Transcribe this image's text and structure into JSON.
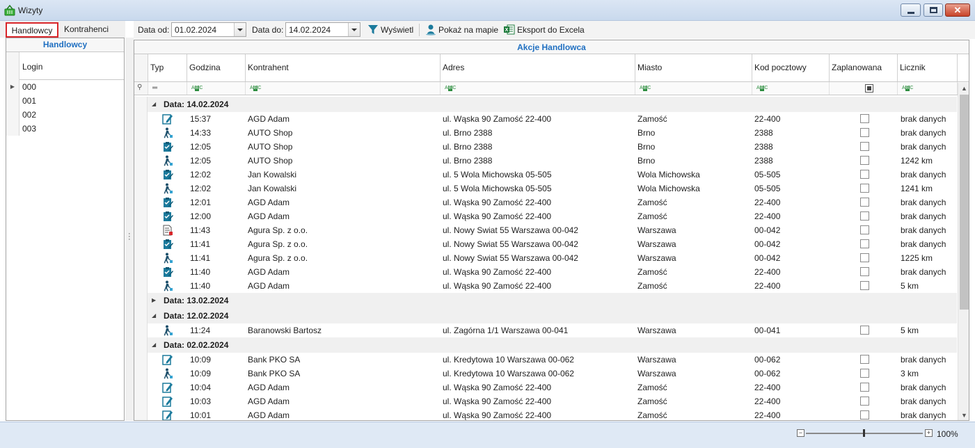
{
  "window": {
    "title": "Wizyty"
  },
  "left": {
    "tabs": [
      "Handlowcy",
      "Kontrahenci"
    ],
    "panel_title": "Handlowcy",
    "column": "Login",
    "logins": [
      "000",
      "001",
      "002",
      "003"
    ]
  },
  "toolbar": {
    "date_from_label": "Data od:",
    "date_from_value": "01.02.2024",
    "date_to_label": "Data do:",
    "date_to_value": "14.02.2024",
    "show_label": "Wyświetl",
    "map_label": "Pokaż na mapie",
    "excel_label": "Eksport do Excela"
  },
  "grid": {
    "title": "Akcje Handlowca",
    "columns": [
      "Typ",
      "Godzina",
      "Kontrahent",
      "Adres",
      "Miasto",
      "Kod pocztowy",
      "Zaplanowana",
      "Licznik"
    ],
    "groups": [
      {
        "label": "Data: 14.02.2024",
        "expanded": true,
        "rows": [
          {
            "icon": "pen-icon",
            "time": "15:37",
            "contractor": "AGD Adam",
            "address": "ul. Wąska 90 Zamość 22-400",
            "city": "Zamość",
            "postal": "22-400",
            "counter": "brak danych"
          },
          {
            "icon": "walk-icon",
            "time": "14:33",
            "contractor": "AUTO Shop",
            "address": "ul.  Brno 2388",
            "city": "Brno",
            "postal": "2388",
            "counter": "brak danych"
          },
          {
            "icon": "clipboard-icon",
            "time": "12:05",
            "contractor": "AUTO Shop",
            "address": "ul.  Brno 2388",
            "city": "Brno",
            "postal": "2388",
            "counter": "brak danych"
          },
          {
            "icon": "walk-icon",
            "time": "12:05",
            "contractor": "AUTO Shop",
            "address": "ul.  Brno 2388",
            "city": "Brno",
            "postal": "2388",
            "counter": "1242 km"
          },
          {
            "icon": "clipboard-icon",
            "time": "12:02",
            "contractor": "Jan Kowalski",
            "address": "ul.  5 Wola Michowska 05-505",
            "city": "Wola Michowska",
            "postal": "05-505",
            "counter": "brak danych"
          },
          {
            "icon": "walk-icon",
            "time": "12:02",
            "contractor": "Jan Kowalski",
            "address": "ul.  5 Wola Michowska 05-505",
            "city": "Wola Michowska",
            "postal": "05-505",
            "counter": "1241 km"
          },
          {
            "icon": "clipboard-icon",
            "time": "12:01",
            "contractor": "AGD Adam",
            "address": "ul. Wąska 90 Zamość 22-400",
            "city": "Zamość",
            "postal": "22-400",
            "counter": "brak danych"
          },
          {
            "icon": "clipboard-icon",
            "time": "12:00",
            "contractor": "AGD Adam",
            "address": "ul. Wąska 90 Zamość 22-400",
            "city": "Zamość",
            "postal": "22-400",
            "counter": "brak danych"
          },
          {
            "icon": "document-icon",
            "time": "11:43",
            "contractor": "Agura Sp. z o.o.",
            "address": "ul. Nowy Swiat 55 Warszawa 00-042",
            "city": "Warszawa",
            "postal": "00-042",
            "counter": "brak danych"
          },
          {
            "icon": "clipboard-icon",
            "time": "11:41",
            "contractor": "Agura Sp. z o.o.",
            "address": "ul. Nowy Swiat 55 Warszawa 00-042",
            "city": "Warszawa",
            "postal": "00-042",
            "counter": "brak danych"
          },
          {
            "icon": "walk-icon",
            "time": "11:41",
            "contractor": "Agura Sp. z o.o.",
            "address": "ul. Nowy Swiat 55 Warszawa 00-042",
            "city": "Warszawa",
            "postal": "00-042",
            "counter": "1225 km"
          },
          {
            "icon": "clipboard-icon",
            "time": "11:40",
            "contractor": "AGD Adam",
            "address": "ul. Wąska 90 Zamość 22-400",
            "city": "Zamość",
            "postal": "22-400",
            "counter": "brak danych"
          },
          {
            "icon": "walk-icon",
            "time": "11:40",
            "contractor": "AGD Adam",
            "address": "ul. Wąska 90 Zamość 22-400",
            "city": "Zamość",
            "postal": "22-400",
            "counter": "5 km"
          }
        ]
      },
      {
        "label": "Data: 13.02.2024",
        "expanded": false,
        "rows": []
      },
      {
        "label": "Data: 12.02.2024",
        "expanded": true,
        "rows": [
          {
            "icon": "walk-icon",
            "time": "11:24",
            "contractor": "Baranowski Bartosz",
            "address": "ul. Zagórna 1/1 Warszawa 00-041",
            "city": "Warszawa",
            "postal": "00-041",
            "counter": "5 km"
          }
        ]
      },
      {
        "label": "Data: 02.02.2024",
        "expanded": true,
        "rows": [
          {
            "icon": "pen-icon",
            "time": "10:09",
            "contractor": "Bank PKO SA",
            "address": "ul. Kredytowa 10 Warszawa 00-062",
            "city": "Warszawa",
            "postal": "00-062",
            "counter": "brak danych"
          },
          {
            "icon": "walk-icon",
            "time": "10:09",
            "contractor": "Bank PKO SA",
            "address": "ul. Kredytowa 10 Warszawa 00-062",
            "city": "Warszawa",
            "postal": "00-062",
            "counter": "3 km"
          },
          {
            "icon": "pen-icon",
            "time": "10:04",
            "contractor": "AGD Adam",
            "address": "ul. Wąska 90 Zamość 22-400",
            "city": "Zamość",
            "postal": "22-400",
            "counter": "brak danych"
          },
          {
            "icon": "pen-icon",
            "time": "10:03",
            "contractor": "AGD Adam",
            "address": "ul. Wąska 90 Zamość 22-400",
            "city": "Zamość",
            "postal": "22-400",
            "counter": "brak danych"
          },
          {
            "icon": "pen-icon",
            "time": "10:01",
            "contractor": "AGD Adam",
            "address": "ul. Wąska 90 Zamość 22-400",
            "city": "Zamość",
            "postal": "22-400",
            "counter": "brak danych"
          }
        ]
      }
    ]
  },
  "status": {
    "zoom": "100%",
    "zoom_level": 0.5
  },
  "colors": {
    "accent": "#1f6fc1",
    "icon_teal": "#1b7a9c",
    "tab_highlight": "#d9262a"
  }
}
